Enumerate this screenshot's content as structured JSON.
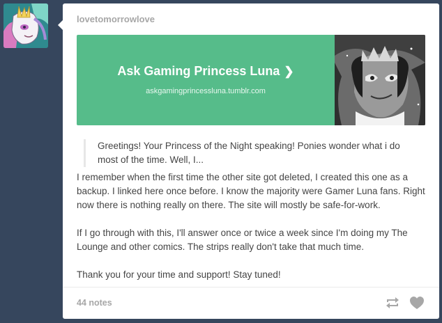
{
  "post": {
    "username": "lovetomorrowlove",
    "link": {
      "title": "Ask Gaming Princess Luna",
      "url": "askgamingprincessluna.tumblr.com"
    },
    "quote": "Greetings! Your Princess of the Night speaking! Ponies wonder what i do most of the time. Well, I...",
    "paragraphs": [
      "I remember when the first time the other site got deleted, I created this one as a backup. I linked here once before. I know the majority were Gamer Luna fans. Right now there is nothing really on there. The site will mostly be safe-for-work.",
      "If I go through with this, I'll answer once or twice a week since I'm doing my The Lounge and other comics. The strips really don't take that much time.",
      "Thank you for your time and support! Stay tuned!"
    ],
    "notes": "44 notes"
  },
  "colors": {
    "background": "#36465d",
    "link_card": "#56bc8a",
    "icon_gray": "#a7a7a7"
  },
  "icons": {
    "reblog": "reblog-icon",
    "like": "heart-icon",
    "chevron": "chevron-right-icon"
  }
}
